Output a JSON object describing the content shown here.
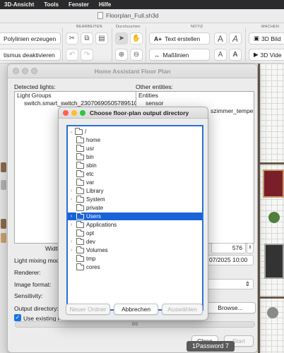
{
  "menubar": {
    "items": [
      "3D-Ansicht",
      "Tools",
      "Fenster",
      "Hilfe"
    ]
  },
  "app_window": {
    "title": "Floorplan_Full.sh3d"
  },
  "toolbar": {
    "groups": {
      "edit": "BEARBEITEN",
      "browse": "Durchsuchen",
      "note": "NOTIZ",
      "make": "MACHEN"
    },
    "polylines_button": "Polylinien erzeugen",
    "magnetism_button": "tismus deaktivieren",
    "text_button": "Text erstellen",
    "dimensions_button": "Maßlinien",
    "text_big_glyph": "A",
    "text_small_glyph": "A",
    "bild_button": "3D Bild",
    "video_button": "3D Vide"
  },
  "ha_window": {
    "title": "Home Assistant Floor Plan",
    "detected_lights_label": "Detected lights:",
    "lights": [
      "Light Groups",
      "switch.smart_switch_2307069050578951086"
    ],
    "other_entities_label": "Other entities:",
    "entities": [
      "Entities",
      "sensor",
      "szimmer_tempera"
    ],
    "width_label": "Width",
    "width_value": "576",
    "light_mixing_label": "Light mixing mode",
    "light_mixing_value": "07/2025 10:00",
    "renderer_label": "Renderer:",
    "image_format_label": "Image format:",
    "sensitivity_label": "Sensitivity:",
    "output_dir_label": "Output directory:",
    "browse_button": "Browse...",
    "use_existing_label": "Use existing r",
    "use_existing_checked": true,
    "progress_text": "0/2",
    "progress_fraction": 0.0,
    "close_button": "Close",
    "start_button": "Start"
  },
  "dialog": {
    "title": "Choose floor-plan output directory",
    "root": "/",
    "folders": [
      {
        "name": "home",
        "expandable": false,
        "selected": false
      },
      {
        "name": "usr",
        "expandable": false,
        "selected": false
      },
      {
        "name": "bin",
        "expandable": false,
        "selected": false
      },
      {
        "name": "sbin",
        "expandable": false,
        "selected": false
      },
      {
        "name": "etc",
        "expandable": false,
        "selected": false
      },
      {
        "name": "var",
        "expandable": false,
        "selected": false
      },
      {
        "name": "Library",
        "expandable": true,
        "selected": false
      },
      {
        "name": "System",
        "expandable": true,
        "selected": false
      },
      {
        "name": "private",
        "expandable": false,
        "selected": false
      },
      {
        "name": "Users",
        "expandable": true,
        "selected": true
      },
      {
        "name": "Applications",
        "expandable": true,
        "selected": false
      },
      {
        "name": "opt",
        "expandable": false,
        "selected": false
      },
      {
        "name": "dev",
        "expandable": true,
        "selected": false
      },
      {
        "name": "Volumes",
        "expandable": true,
        "selected": false
      },
      {
        "name": "tmp",
        "expandable": false,
        "selected": false
      },
      {
        "name": "cores",
        "expandable": false,
        "selected": false
      }
    ],
    "new_folder_button": "Neuer Ordner",
    "cancel_button": "Abbrechen",
    "select_button": "Auswählen"
  },
  "tooltip": {
    "text": "1Password 7"
  },
  "colors": {
    "selection": "#1a62d8",
    "focus_ring": "#2a6fd6",
    "close_dot": "#ff5f57",
    "min_dot": "#febc2e",
    "max_dot": "#28c840"
  }
}
